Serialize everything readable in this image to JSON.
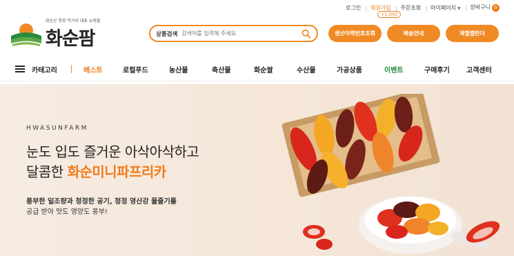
{
  "util_nav": {
    "login": "로그인",
    "join": "회원가입",
    "join_bonus": "+1,000",
    "order_check": "주문조회",
    "mypage": "마이페이지",
    "cart": "장바구니",
    "cart_count": "0"
  },
  "logo": {
    "tagline": "화순군 청정 먹거리 대표 쇼핑몰",
    "name": "화순팜"
  },
  "search": {
    "scope_label": "상품검색",
    "placeholder": "검색어를 입력해 주세요."
  },
  "header_buttons": {
    "trace": "생산이력번호조회",
    "delivery": "배송안내",
    "calendar": "제철캘린더"
  },
  "nav": {
    "category": "카테고리",
    "items": [
      "베스트",
      "로컬푸드",
      "농산물",
      "축산물",
      "화순쌀",
      "수산물",
      "가공상품",
      "이벤트",
      "구매후기",
      "고객센터"
    ]
  },
  "banner": {
    "eyebrow": "HWASUNFARM",
    "headline_1": "눈도 입도 즐거운 아삭아삭하고",
    "headline_2_prefix": "달콤한 ",
    "headline_2_highlight": "화순미니파프리카",
    "desc_1": "풍부한 일조량과 청정한 공기, 청정 영산강 물줄기를",
    "desc_2": "공급 받아 맛도 영양도 풍부!"
  },
  "colors": {
    "accent": "#f08a24",
    "event_green": "#2a8a3c"
  }
}
